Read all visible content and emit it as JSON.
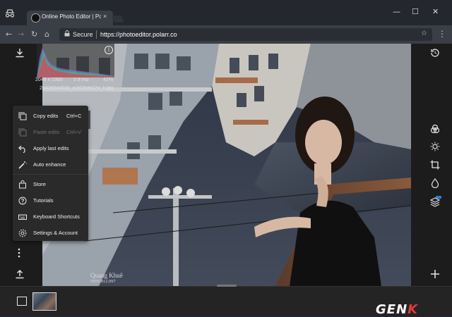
{
  "browser": {
    "tab_title": "Online Photo Editor | Polarr",
    "tab_close": "×",
    "window_controls": {
      "minimize": "—",
      "maximize": "☐",
      "close": "✕"
    },
    "nav": {
      "back": "←",
      "forward": "→",
      "reload": "↻",
      "home": "⌂"
    },
    "secure_label": "Secure",
    "url": "https://photoeditor.polarr.co",
    "star": "☆",
    "menu": "⋮"
  },
  "image_info": {
    "dimensions": "2048 x 1365",
    "megapixels": "2.8 mp",
    "zoom": "42%",
    "filename": "28428944530_e2d20de17e_k.jpg"
  },
  "menu": {
    "items": [
      {
        "label": "Copy edits",
        "shortcut": "Ctrl+C",
        "disabled": false
      },
      {
        "label": "Paste edits",
        "shortcut": "Ctrl+V",
        "disabled": true
      },
      {
        "label": "Apply last edits",
        "shortcut": "",
        "disabled": false
      },
      {
        "label": "Auto enhance",
        "shortcut": "",
        "disabled": false
      },
      {
        "label": "Store",
        "shortcut": "",
        "disabled": false
      },
      {
        "label": "Tutorials",
        "shortcut": "",
        "disabled": false
      },
      {
        "label": "Keyboard Shortcuts",
        "shortcut": "",
        "disabled": false
      },
      {
        "label": "Settings & Account",
        "shortcut": "",
        "disabled": false
      }
    ]
  },
  "watermark": {
    "name": "Quang Khuê",
    "phone": "0909.812.097"
  },
  "brand": {
    "text_a": "GEN",
    "text_b": "K"
  },
  "icons": {
    "left": [
      "download-icon",
      "more-vert-icon",
      "upload-icon"
    ],
    "right": [
      "history-icon",
      "filters-icon",
      "adjust-icon",
      "crop-icon",
      "retouch-icon",
      "layers-icon",
      "add-icon"
    ]
  },
  "colors": {
    "accent_red": "#e53935",
    "layers_badge": "#2f7fd6"
  }
}
